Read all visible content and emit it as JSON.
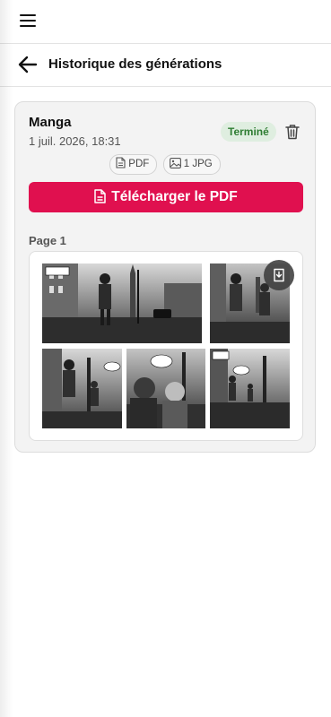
{
  "topbar": {
    "menu_icon": "hamburger-menu-icon"
  },
  "header": {
    "back_icon": "arrow-left-icon",
    "title": "Historique des générations"
  },
  "generation": {
    "title": "Manga",
    "date": "1 juil. 2026, 18:31",
    "status": "Terminé",
    "status_color": "#2e7d32",
    "delete_icon": "trash-icon",
    "chips": [
      {
        "icon": "document-icon",
        "label": "PDF"
      },
      {
        "icon": "image-icon",
        "label": "1 JPG"
      }
    ],
    "download_label": "Télécharger le PDF",
    "download_color": "#e0104f",
    "pages": [
      {
        "label": "Page 1",
        "save_icon": "save-download-icon"
      }
    ]
  }
}
